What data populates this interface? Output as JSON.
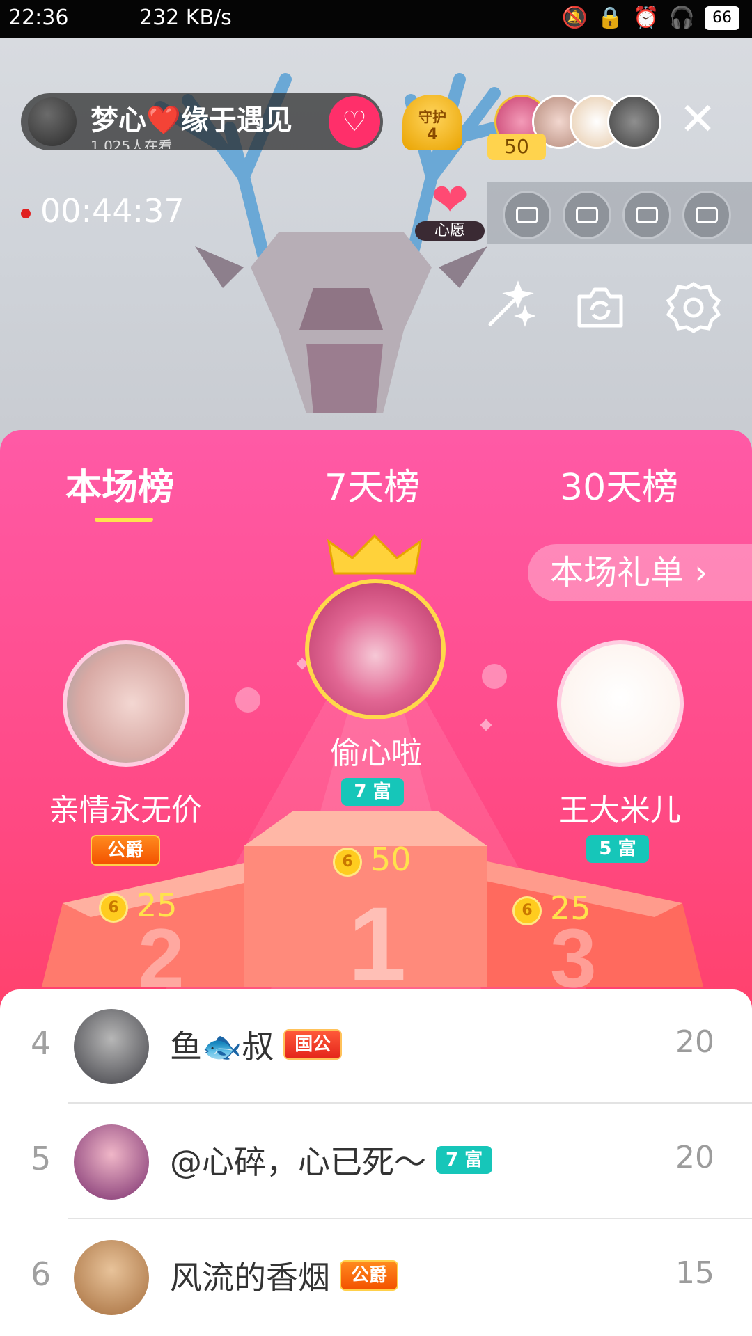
{
  "status_bar": {
    "time": "22:36",
    "net_speed": "232 KB/s",
    "battery": "66"
  },
  "live": {
    "host_name": "梦心❤️缘于遇见",
    "viewers": "1,025人在看",
    "guard_label": "守护",
    "guard_count": "4",
    "viewer_count_badge": "50",
    "timer": "00:44:37",
    "wish_label": "心愿",
    "icons": [
      "magic-wand-icon",
      "flip-camera-icon",
      "gear-icon",
      "close-icon"
    ]
  },
  "ranking": {
    "tabs": [
      "本场榜",
      "7天榜",
      "30天榜"
    ],
    "active_tab": 0,
    "gift_list_button": "本场礼单 ›",
    "coin_symbol": "6",
    "top3": [
      {
        "rank": 1,
        "name": "偷心啦",
        "badge": "7 富",
        "coins": "50"
      },
      {
        "rank": 2,
        "name": "亲情永无价",
        "badge": "公爵",
        "coins": "25"
      },
      {
        "rank": 3,
        "name": "王大米儿",
        "badge": "5 富",
        "coins": "25"
      }
    ],
    "list": [
      {
        "rank": "4",
        "name": "鱼🐟叔",
        "badge": "国公",
        "score": "20"
      },
      {
        "rank": "5",
        "name": "@心碎，心已死～",
        "badge": "7 富",
        "score": "20"
      },
      {
        "rank": "6",
        "name": "风流的香烟",
        "badge": "公爵",
        "score": "15"
      }
    ]
  }
}
